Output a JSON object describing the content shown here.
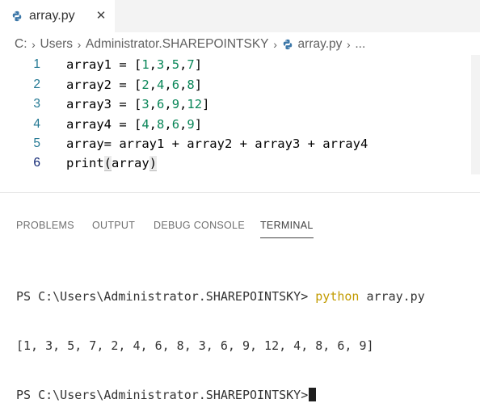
{
  "tab": {
    "title": "array.py",
    "close_glyph": "✕",
    "icon": "python-icon"
  },
  "breadcrumb": {
    "items": [
      "C:",
      "Users",
      "Administrator.SHAREPOINTSKY",
      "array.py",
      "..."
    ],
    "separator": "›"
  },
  "editor": {
    "lines": [
      {
        "number": "1",
        "text": "array1 = [1,3,5,7]"
      },
      {
        "number": "2",
        "text": "array2 = [2,4,6,8]"
      },
      {
        "number": "3",
        "text": "array3 = [3,6,9,12]"
      },
      {
        "number": "4",
        "text": "array4 = [4,8,6,9]"
      },
      {
        "number": "5",
        "text": "array= array1 + array2 + array3 + array4"
      },
      {
        "number": "6",
        "text": "print(array)"
      }
    ],
    "colors": {
      "number_literal": "#098658",
      "line_number": "#237893",
      "active_line_number": "#0b216f"
    }
  },
  "panel": {
    "tabs": [
      "PROBLEMS",
      "OUTPUT",
      "DEBUG CONSOLE",
      "TERMINAL"
    ],
    "active_tab": "TERMINAL"
  },
  "terminal": {
    "prompt": "PS C:\\Users\\Administrator.SHAREPOINTSKY>",
    "command_program": "python",
    "command_args": "array.py",
    "output": "[1, 3, 5, 7, 2, 4, 6, 8, 3, 6, 9, 12, 4, 8, 6, 9]",
    "prompt2": "PS C:\\Users\\Administrator.SHAREPOINTSKY>",
    "command_color": "#c29b00"
  }
}
